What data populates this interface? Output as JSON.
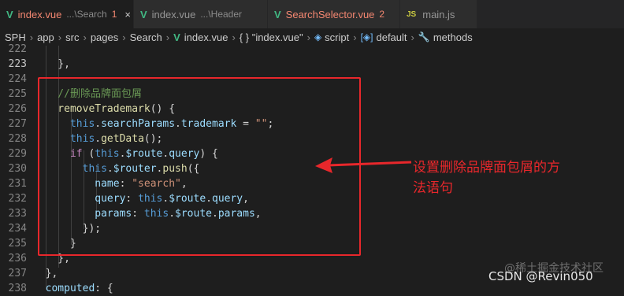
{
  "tabs": [
    {
      "name": "index.vue",
      "desc": "...\\Search",
      "badge": "1",
      "active": true,
      "icon": "vue-icon",
      "close": "×"
    },
    {
      "name": "index.vue",
      "desc": "...\\Header",
      "badge": "",
      "active": false,
      "icon": "vue-icon"
    },
    {
      "name": "SearchSelector.vue",
      "desc": "",
      "badge": "2",
      "active": false,
      "icon": "vue-icon"
    },
    {
      "name": "main.js",
      "desc": "",
      "badge": "",
      "active": false,
      "icon": "js-icon",
      "icon_text": "JS"
    }
  ],
  "breadcrumb": {
    "items": [
      "SPH",
      "app",
      "src",
      "pages",
      "Search",
      "index.vue",
      "{ } \"index.vue\"",
      "script",
      "default",
      "methods"
    ]
  },
  "code_lines": [
    {
      "num": "222",
      "tokens": [
        [
          "pu",
          ""
        ]
      ]
    },
    {
      "num": "223",
      "tokens": [
        [
          "pu",
          "    },"
        ]
      ]
    },
    {
      "num": "224",
      "tokens": [
        [
          "pu",
          ""
        ]
      ]
    },
    {
      "num": "225",
      "tokens": [
        [
          "cm",
          "    //删除品牌面包屑"
        ]
      ]
    },
    {
      "num": "226",
      "tokens": [
        [
          "fn",
          "    removeTrademark"
        ],
        [
          "pu",
          "() {"
        ]
      ]
    },
    {
      "num": "227",
      "tokens": [
        [
          "kw",
          "      this"
        ],
        [
          "pu",
          "."
        ],
        [
          "pr",
          "searchParams"
        ],
        [
          "pu",
          "."
        ],
        [
          "pr",
          "trademark"
        ],
        [
          "pu",
          " = "
        ],
        [
          "st",
          "\"\""
        ],
        [
          "pu",
          ";"
        ]
      ]
    },
    {
      "num": "228",
      "tokens": [
        [
          "kw",
          "      this"
        ],
        [
          "pu",
          "."
        ],
        [
          "fn",
          "getData"
        ],
        [
          "pu",
          "();"
        ]
      ]
    },
    {
      "num": "229",
      "tokens": [
        [
          "ct",
          "      if"
        ],
        [
          "pu",
          " ("
        ],
        [
          "kw",
          "this"
        ],
        [
          "pu",
          "."
        ],
        [
          "pr",
          "$route"
        ],
        [
          "pu",
          "."
        ],
        [
          "pr",
          "query"
        ],
        [
          "pu",
          ") {"
        ]
      ]
    },
    {
      "num": "230",
      "tokens": [
        [
          "kw",
          "        this"
        ],
        [
          "pu",
          "."
        ],
        [
          "pr",
          "$router"
        ],
        [
          "pu",
          "."
        ],
        [
          "fn",
          "push"
        ],
        [
          "pu",
          "({"
        ]
      ]
    },
    {
      "num": "231",
      "tokens": [
        [
          "pr",
          "          name"
        ],
        [
          "pu",
          ": "
        ],
        [
          "st",
          "\"search\""
        ],
        [
          "pu",
          ","
        ]
      ]
    },
    {
      "num": "232",
      "tokens": [
        [
          "pr",
          "          query"
        ],
        [
          "pu",
          ": "
        ],
        [
          "kw",
          "this"
        ],
        [
          "pu",
          "."
        ],
        [
          "pr",
          "$route"
        ],
        [
          "pu",
          "."
        ],
        [
          "pr",
          "query"
        ],
        [
          "pu",
          ","
        ]
      ]
    },
    {
      "num": "233",
      "tokens": [
        [
          "pr",
          "          params"
        ],
        [
          "pu",
          ": "
        ],
        [
          "kw",
          "this"
        ],
        [
          "pu",
          "."
        ],
        [
          "pr",
          "$route"
        ],
        [
          "pu",
          "."
        ],
        [
          "pr",
          "params"
        ],
        [
          "pu",
          ","
        ]
      ]
    },
    {
      "num": "234",
      "tokens": [
        [
          "pu",
          "        });"
        ]
      ]
    },
    {
      "num": "235",
      "tokens": [
        [
          "pu",
          "      }"
        ]
      ]
    },
    {
      "num": "236",
      "tokens": [
        [
          "pu",
          "    },"
        ]
      ]
    },
    {
      "num": "237",
      "tokens": [
        [
          "pu",
          "  },"
        ]
      ]
    },
    {
      "num": "238",
      "tokens": [
        [
          "pr",
          "  computed"
        ],
        [
          "pu",
          ": {"
        ]
      ]
    }
  ],
  "annotation": {
    "text": "设置删除品牌面包屑的方法语句"
  },
  "watermarks": {
    "juejin": "@稀土掘金技术社区",
    "csdn": "CSDN @Revin050"
  },
  "colors": {
    "highlight": "#e8272b",
    "vue": "#41b883",
    "background": "#1e1e1e"
  }
}
